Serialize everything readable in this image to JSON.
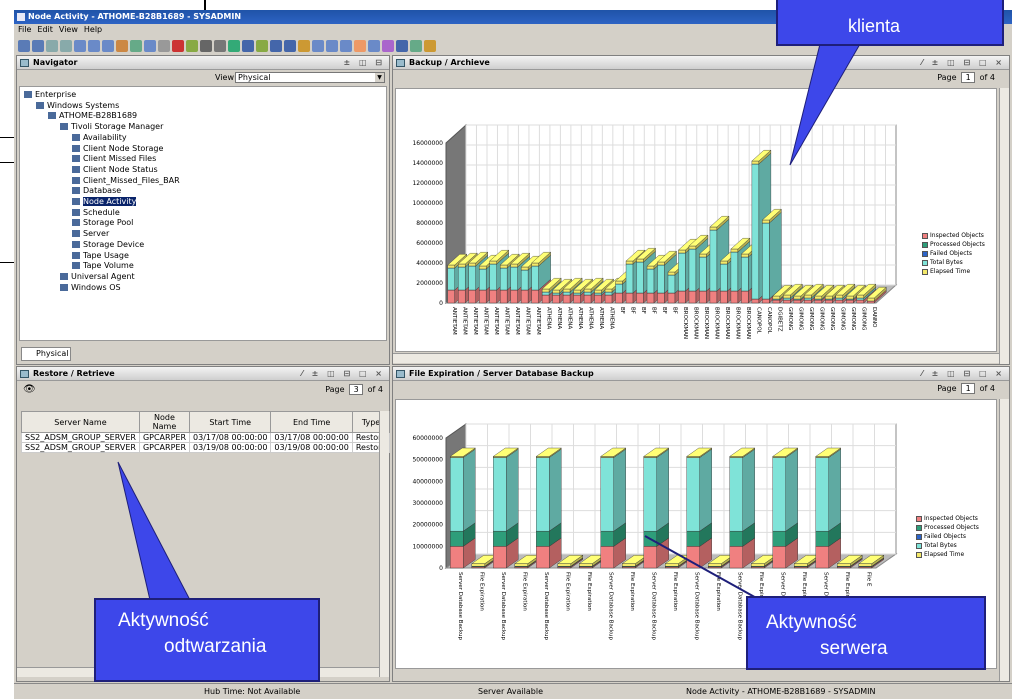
{
  "window": {
    "title": "Node Activity - ATHOME-B28B1689 - SYSADMIN"
  },
  "menu": [
    "File",
    "Edit",
    "View",
    "Help"
  ],
  "navigator": {
    "title": "Navigator",
    "view_label": "View",
    "view_value": "Physical",
    "tab": "Physical",
    "tree": [
      {
        "label": "Enterprise",
        "level": 0
      },
      {
        "label": "Windows Systems",
        "level": 1
      },
      {
        "label": "ATHOME-B28B1689",
        "level": 2
      },
      {
        "label": "Tivoli Storage Manager",
        "level": 3
      },
      {
        "label": "Availability",
        "level": 4
      },
      {
        "label": "Client Node Storage",
        "level": 4
      },
      {
        "label": "Client Missed Files",
        "level": 4
      },
      {
        "label": "Client Node Status",
        "level": 4
      },
      {
        "label": "Client_Missed_Files_BAR",
        "level": 4
      },
      {
        "label": "Database",
        "level": 4
      },
      {
        "label": "Node Activity",
        "level": 4,
        "selected": true
      },
      {
        "label": "Schedule",
        "level": 4
      },
      {
        "label": "Storage Pool",
        "level": 4
      },
      {
        "label": "Server",
        "level": 4
      },
      {
        "label": "Storage Device",
        "level": 4
      },
      {
        "label": "Tape Usage",
        "level": 4
      },
      {
        "label": "Tape Volume",
        "level": 4
      },
      {
        "label": "Universal Agent",
        "level": 3
      },
      {
        "label": "Windows OS",
        "level": 3
      }
    ]
  },
  "restore": {
    "title": "Restore / Retrieve",
    "page_label": "Page",
    "page_value": "3",
    "page_total": "of 4",
    "columns": [
      "Server Name",
      "Node Name",
      "Start Time",
      "End Time",
      "Type"
    ],
    "rows": [
      [
        "SS2_ADSM_GROUP_SERVER",
        "GPCARPER",
        "03/17/08 00:00:00",
        "03/17/08 00:00:00",
        "Restore"
      ],
      [
        "SS2_ADSM_GROUP_SERVER",
        "GPCARPER",
        "03/19/08 00:00:00",
        "03/19/08 00:00:00",
        "Restore"
      ]
    ]
  },
  "backup_panel": {
    "title": "Backup / Archieve",
    "page_label": "Page",
    "page_value": "1",
    "page_total": "of 4"
  },
  "expiration_panel": {
    "title": "File Expiration / Server Database Backup",
    "page_label": "Page",
    "page_value": "1",
    "page_total": "of 4"
  },
  "legend": [
    "Inspected Objects",
    "Processed Objects",
    "Failed Objects",
    "Total Bytes",
    "Elapsed Time"
  ],
  "colors": {
    "inspected": "#f08080",
    "processed": "#2e9e7a",
    "failed": "#2d64c8",
    "total": "#7fe3d8",
    "elapsed": "#f4e96a",
    "callout": "#3d47ea"
  },
  "chart_data": [
    {
      "type": "bar",
      "title": "Backup / Archieve",
      "ylim": [
        0,
        16000000
      ],
      "yticks": [
        "0",
        "2000000",
        "4000000",
        "6000000",
        "8000000",
        "10000000",
        "12000000",
        "14000000",
        "16000000"
      ],
      "categories": [
        "ANTIETAM",
        "ANTIETAM",
        "ANTIETAM",
        "ANTIETAM",
        "ANTIETAM",
        "ANTIETAM",
        "ANTIETAM",
        "ANTIETAM",
        "ANTIETAM",
        "ATHENA",
        "ATHENA",
        "ATHENA",
        "ATHENA",
        "ATHENA",
        "ATHENA",
        "ATHENA",
        "BF",
        "BF",
        "BF",
        "BF",
        "BF",
        "BF",
        "BROCKMAN",
        "BROCKMAN",
        "BROCKMAN",
        "BROCKMAN",
        "BROCKMAN",
        "BROCKMAN",
        "BROCKMAN",
        "CANOPOL",
        "CANOPOL",
        "DGIBETZ",
        "GIMONG",
        "GIMONG",
        "GIMONG",
        "GIMONG",
        "GIMONG",
        "GIMONG",
        "GIMONG",
        "GIMONG",
        "DANNO"
      ],
      "series": [
        {
          "name": "Inspected Objects",
          "values": [
            1300000,
            1300000,
            1300000,
            1300000,
            1300000,
            1300000,
            1300000,
            1300000,
            1300000,
            800000,
            800000,
            800000,
            800000,
            800000,
            800000,
            800000,
            1000000,
            1000000,
            1000000,
            1000000,
            1000000,
            1000000,
            1200000,
            1200000,
            1200000,
            1200000,
            1200000,
            1200000,
            1200000,
            400000,
            400000,
            300000,
            300000,
            300000,
            300000,
            300000,
            300000,
            300000,
            300000,
            300000,
            200000
          ]
        },
        {
          "name": "Total Bytes",
          "values": [
            2200000,
            2300000,
            2400000,
            2100000,
            2600000,
            2200000,
            2300000,
            2000000,
            2400000,
            300000,
            200000,
            300000,
            200000,
            300000,
            200000,
            300000,
            900000,
            2900000,
            3100000,
            2400000,
            2800000,
            1800000,
            3800000,
            4200000,
            3400000,
            6100000,
            2700000,
            3900000,
            3400000,
            13500000,
            7600000,
            100000,
            200000,
            100000,
            200000,
            100000,
            100000,
            200000,
            100000,
            200000,
            0
          ]
        },
        {
          "name": "Elapsed Time",
          "values": [
            300000,
            300000,
            300000,
            300000,
            300000,
            300000,
            300000,
            300000,
            300000,
            300000,
            300000,
            300000,
            300000,
            300000,
            300000,
            300000,
            300000,
            300000,
            300000,
            300000,
            300000,
            300000,
            300000,
            300000,
            300000,
            300000,
            300000,
            300000,
            300000,
            300000,
            300000,
            300000,
            300000,
            300000,
            300000,
            300000,
            300000,
            300000,
            300000,
            300000,
            300000
          ]
        }
      ]
    },
    {
      "type": "bar",
      "title": "File Expiration / Server Database Backup",
      "ylim": [
        0,
        60000000
      ],
      "yticks": [
        "0",
        "10000000",
        "20000000",
        "30000000",
        "40000000",
        "50000000",
        "60000000"
      ],
      "categories": [
        "Server Database Backup",
        "File Expiration",
        "Server Database Backup",
        "File Expiration",
        "Server Database Backup",
        "File Expiration",
        "File Expiration",
        "Server Database Backup",
        "File Expiration",
        "Server Database Backup",
        "File Expiration",
        "Server Database Backup",
        "File Expiration",
        "Server Database Backup",
        "File Expiration",
        "Server Database Backup",
        "File Expiration",
        "Server Database Backup",
        "File Expiration",
        "File E"
      ],
      "series": [
        {
          "name": "Inspected Objects",
          "values": [
            10000000,
            500000,
            10000000,
            500000,
            10000000,
            500000,
            500000,
            10000000,
            500000,
            10000000,
            500000,
            10000000,
            500000,
            10000000,
            500000,
            10000000,
            500000,
            10000000,
            500000,
            500000
          ]
        },
        {
          "name": "Processed Objects",
          "values": [
            7000000,
            300000,
            7000000,
            300000,
            7000000,
            300000,
            300000,
            7000000,
            300000,
            7000000,
            300000,
            7000000,
            300000,
            7000000,
            300000,
            7000000,
            300000,
            7000000,
            300000,
            300000
          ]
        },
        {
          "name": "Total Bytes",
          "values": [
            34000000,
            0,
            34000000,
            0,
            34000000,
            0,
            0,
            34000000,
            0,
            34000000,
            0,
            34000000,
            0,
            34000000,
            0,
            34000000,
            0,
            34000000,
            0,
            0
          ]
        },
        {
          "name": "Elapsed Time",
          "values": [
            500000,
            1200000,
            500000,
            1200000,
            500000,
            1200000,
            1200000,
            500000,
            1200000,
            500000,
            1200000,
            500000,
            1200000,
            500000,
            1200000,
            500000,
            1200000,
            500000,
            1200000,
            1200000
          ]
        }
      ]
    }
  ],
  "status": {
    "hub": "Hub Time: Not Available",
    "server": "Server Available",
    "node": "Node Activity - ATHOME-B28B1689 - SYSADMIN"
  },
  "callouts": {
    "top": "klienta",
    "left_line1": "Aktywność",
    "left_line2": "odtwarzania",
    "right_line1": "Aktywność",
    "right_line2": "serwera"
  }
}
